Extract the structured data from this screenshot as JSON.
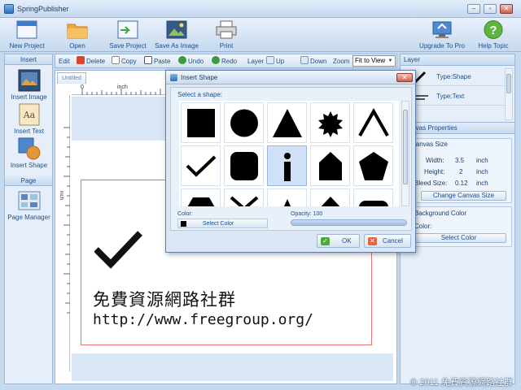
{
  "window": {
    "title": "SpringPublisher",
    "min_label": "–",
    "max_label": "▫",
    "close_label": "✕"
  },
  "toolbar": {
    "new_project": "New Project",
    "open": "Open",
    "save_project": "Save Project",
    "save_as_image": "Save As Image",
    "print": "Print",
    "upgrade": "Upgrade To Pro",
    "help": "Help Topic"
  },
  "left_panel": {
    "insert_header": "Insert",
    "insert_image": "Insert Image",
    "insert_text": "Insert Text",
    "insert_shape": "Insert Shape",
    "page_header": "Page",
    "page_manager": "Page Manager"
  },
  "edit_toolbar": {
    "edit": "Edit",
    "delete": "Delete",
    "copy": "Copy",
    "paste": "Paste",
    "undo": "Undo",
    "redo": "Redo",
    "layer": "Layer",
    "up": "Up",
    "down": "Down",
    "zoom": "Zoom",
    "zoom_value": "Fit to View"
  },
  "canvas": {
    "tab": "Untitled",
    "ruler_zero": "0",
    "ruler_unit": "inch",
    "ruler_left_unit": "inch",
    "chinese_text": "免費資源網路社群",
    "url_text": "http://www.freegroup.org/"
  },
  "layer_panel": {
    "header": "Layer",
    "items": [
      {
        "label": "Type:Shape"
      },
      {
        "label": "Type:Text"
      }
    ]
  },
  "canvas_properties": {
    "header": "Canvas Properties",
    "size_group": "Canvas Size",
    "width_label": "Width:",
    "width_value": "3.5",
    "width_unit": "inch",
    "height_label": "Height:",
    "height_value": "2",
    "height_unit": "inch",
    "bleed_label": "Bleed Size:",
    "bleed_value": "0.12",
    "bleed_unit": "inch",
    "change_size_button": "Change Canvas Size",
    "bg_group": "Background Color",
    "color_label": "Color:",
    "select_color_button": "Select Color"
  },
  "dialog": {
    "title": "Insert Shape",
    "select_label": "Select a shape:",
    "color_label": "Color:",
    "select_color": "Select Color",
    "opacity_label": "Opacity:",
    "opacity_value": "100",
    "ok": "OK",
    "cancel": "Cancel"
  },
  "footer": {
    "copyright": "© 2011 免費資源網路社群"
  },
  "colors": {
    "accent": "#1e4e8a",
    "panel_bg": "#e6eff9",
    "page_border": "#e0756a"
  }
}
